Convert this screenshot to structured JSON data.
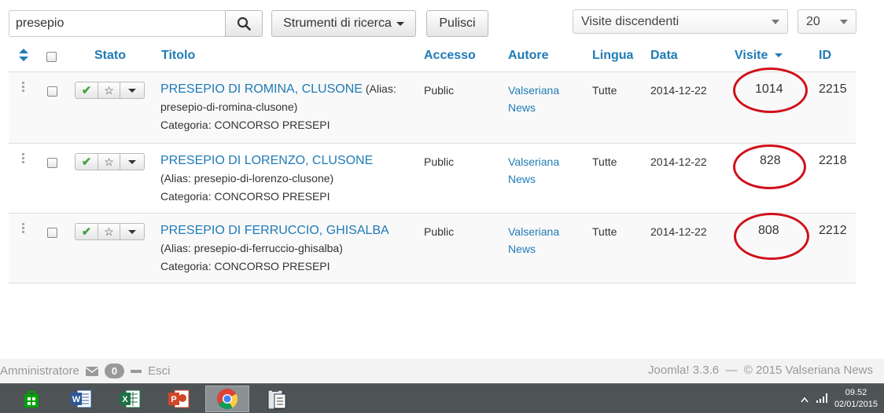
{
  "search": {
    "value": "presepio"
  },
  "toolbar": {
    "search_tools_label": "Strumenti di ricerca",
    "clear_label": "Pulisci",
    "sort_select": "Visite discendenti",
    "limit_select": "20"
  },
  "columns": {
    "status": "Stato",
    "title": "Titolo",
    "access": "Accesso",
    "author": "Autore",
    "language": "Lingua",
    "date": "Data",
    "hits": "Visite",
    "id": "ID"
  },
  "articles": [
    {
      "title": "PRESEPIO DI ROMINA, CLUSONE",
      "alias_prefix": "(Alias:",
      "alias": "presepio-di-romina-clusone)",
      "category": "Categoria: CONCORSO PRESEPI",
      "access": "Public",
      "author_line1": "Valseriana",
      "author_line2": "News",
      "language": "Tutte",
      "date": "2014-12-22",
      "hits": "1014",
      "id": "2215"
    },
    {
      "title": "PRESEPIO DI LORENZO, CLUSONE",
      "alias_prefix": "",
      "alias": "(Alias: presepio-di-lorenzo-clusone)",
      "category": "Categoria: CONCORSO PRESEPI",
      "access": "Public",
      "author_line1": "Valseriana",
      "author_line2": "News",
      "language": "Tutte",
      "date": "2014-12-22",
      "hits": "828",
      "id": "2218"
    },
    {
      "title": "PRESEPIO DI FERRUCCIO, GHISALBA",
      "alias_prefix": "",
      "alias": "(Alias: presepio-di-ferruccio-ghisalba)",
      "category": "Categoria: CONCORSO PRESEPI",
      "access": "Public",
      "author_line1": "Valseriana",
      "author_line2": "News",
      "language": "Tutte",
      "date": "2014-12-22",
      "hits": "808",
      "id": "2212"
    }
  ],
  "footer": {
    "user": "Amministratore",
    "messages_count": "0",
    "logout": "Esci",
    "version": "Joomla! 3.3.6",
    "separator": "—",
    "copyright": "© 2015 Valseriana News"
  },
  "taskbar": {
    "time": "09.52",
    "date": "02/01/2015",
    "apps": [
      "store-icon",
      "word-icon",
      "excel-icon",
      "powerpoint-icon",
      "chrome-icon",
      "clipboard-icon"
    ]
  },
  "colors": {
    "link": "#1f7bb6",
    "highlight": "#d0101b",
    "published": "#46a546"
  }
}
